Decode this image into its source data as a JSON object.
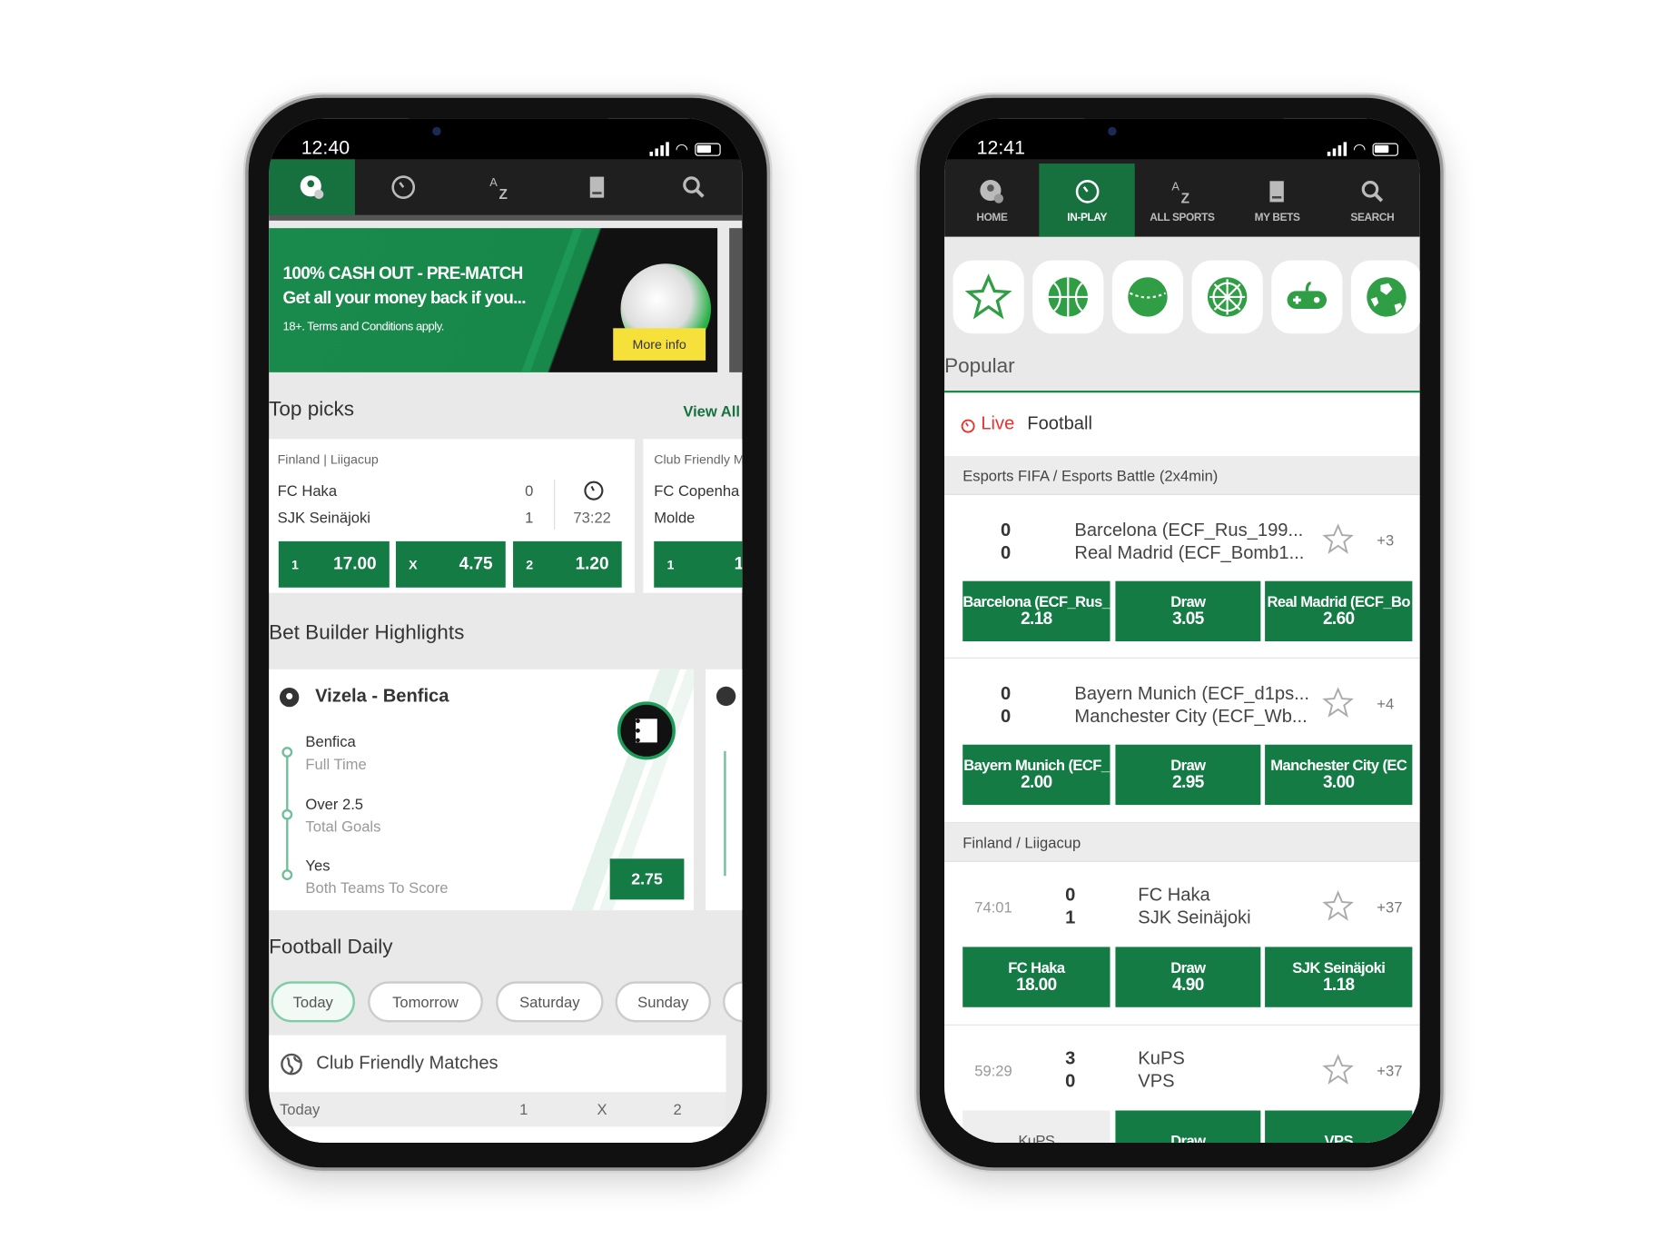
{
  "colors": {
    "brand_green": "#147b45",
    "nav_dark": "#1f1f1f",
    "banner_cta": "#f6e03a",
    "live_red": "#e8332f"
  },
  "left": {
    "status": {
      "time": "12:40"
    },
    "nav": {
      "tabs": [
        {
          "icon": "home-football-icon",
          "active": true
        },
        {
          "icon": "in-play-clock-icon"
        },
        {
          "icon": "a-z-sports-icon"
        },
        {
          "icon": "my-bets-icon"
        },
        {
          "icon": "search-icon"
        }
      ]
    },
    "banner": {
      "title": "100% CASH OUT - PRE-MATCH",
      "subtitle": "Get all your money back if you...",
      "terms": "18+. Terms and Conditions apply.",
      "cta": "More info"
    },
    "top_picks": {
      "title": "Top picks",
      "view_all": "View All",
      "cards": [
        {
          "league": "Finland | Liigacup",
          "home": "FC Haka",
          "away": "SJK Seinäjoki",
          "home_score": "0",
          "away_score": "1",
          "clock": "73:22",
          "odds": [
            {
              "k": "1",
              "v": "17.00"
            },
            {
              "k": "X",
              "v": "4.75"
            },
            {
              "k": "2",
              "v": "1.20"
            }
          ]
        },
        {
          "league": "Club Friendly M",
          "home": "FC Copenha",
          "away": "Molde",
          "odds": [
            {
              "k": "1",
              "v": "1."
            }
          ]
        }
      ]
    },
    "bet_builder": {
      "title": "Bet Builder Highlights",
      "match": "Vizela - Benfica",
      "legs": [
        {
          "pick": "Benfica",
          "market": "Full Time"
        },
        {
          "pick": "Over 2.5",
          "market": "Total Goals"
        },
        {
          "pick": "Yes",
          "market": "Both Teams To Score"
        }
      ],
      "price": "2.75"
    },
    "football_daily": {
      "title": "Football Daily",
      "days": [
        "Today",
        "Tomorrow",
        "Saturday",
        "Sunday"
      ],
      "active_day": "Today",
      "competition": "Club Friendly Matches",
      "header": {
        "date": "Today",
        "c1": "1",
        "cx": "X",
        "c2": "2"
      }
    }
  },
  "right": {
    "status": {
      "time": "12:41"
    },
    "nav": {
      "tabs": [
        {
          "label": "HOME",
          "icon": "home-football-icon"
        },
        {
          "label": "IN-PLAY",
          "icon": "in-play-clock-icon",
          "active": true
        },
        {
          "label": "ALL SPORTS",
          "icon": "a-z-sports-icon"
        },
        {
          "label": "MY BETS",
          "icon": "my-bets-icon"
        },
        {
          "label": "SEARCH",
          "icon": "search-icon"
        }
      ]
    },
    "sports": [
      "favourites-star-icon",
      "basketball-icon",
      "cricket-icon",
      "darts-icon",
      "esports-gamepad-icon",
      "football-icon"
    ],
    "popular": "Popular",
    "live_label": "Live",
    "sport": "Football",
    "groups": [
      {
        "name": "Esports FIFA / Esports Battle (2x4min)",
        "matches": [
          {
            "home": "Barcelona (ECF_Rus_199...",
            "away": "Real Madrid (ECF_Bomb1...",
            "hs": "0",
            "as": "0",
            "more": "+3",
            "odds": [
              {
                "n": "Barcelona (ECF_Rus_",
                "v": "2.18"
              },
              {
                "n": "Draw",
                "v": "3.05"
              },
              {
                "n": "Real Madrid (ECF_Bo",
                "v": "2.60"
              }
            ]
          },
          {
            "home": "Bayern Munich (ECF_d1ps...",
            "away": "Manchester City (ECF_Wb...",
            "hs": "0",
            "as": "0",
            "more": "+4",
            "odds": [
              {
                "n": "Bayern Munich (ECF_",
                "v": "2.00"
              },
              {
                "n": "Draw",
                "v": "2.95"
              },
              {
                "n": "Manchester City (EC",
                "v": "3.00"
              }
            ]
          }
        ]
      },
      {
        "name": "Finland / Liigacup",
        "matches": [
          {
            "time": "74:01",
            "home": "FC Haka",
            "away": "SJK Seinäjoki",
            "hs": "0",
            "as": "1",
            "more": "+37",
            "odds": [
              {
                "n": "FC Haka",
                "v": "18.00"
              },
              {
                "n": "Draw",
                "v": "4.90"
              },
              {
                "n": "SJK Seinäjoki",
                "v": "1.18"
              }
            ]
          },
          {
            "time": "59:29",
            "home": "KuPS",
            "away": "VPS",
            "hs": "3",
            "as": "0",
            "more": "+37",
            "odds": [
              {
                "n": "KuPS",
                "v": ""
              },
              {
                "n": "Draw",
                "v": ""
              },
              {
                "n": "VPS",
                "v": ""
              }
            ]
          }
        ]
      }
    ]
  }
}
